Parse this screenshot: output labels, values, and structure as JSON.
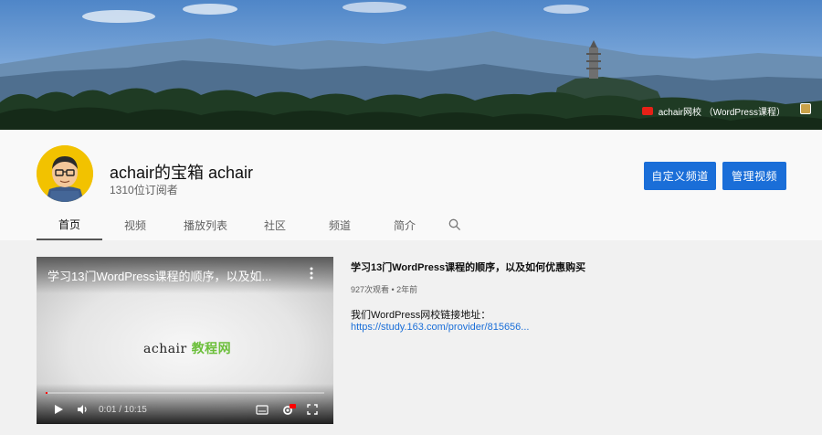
{
  "banner": {
    "link_text": "achair网校 （WordPress课程）",
    "icon": "youtube-play-icon"
  },
  "channel": {
    "name": "achair的宝箱 achair",
    "subscribers": "1310位订阅者",
    "avatar_icon": "cartoon-avatar"
  },
  "buttons": {
    "customize": "自定义频道",
    "manage": "管理视频",
    "color": "#1a6ed8"
  },
  "tabs": [
    {
      "label": "首页",
      "active": true
    },
    {
      "label": "视频",
      "active": false
    },
    {
      "label": "播放列表",
      "active": false
    },
    {
      "label": "社区",
      "active": false
    },
    {
      "label": "频道",
      "active": false
    },
    {
      "label": "简介",
      "active": false
    }
  ],
  "search_icon": "search-icon",
  "featured_video": {
    "player_title": "学习13门WordPress课程的顺序，以及如...",
    "logo_text": "achair",
    "logo_cn": "教程网",
    "time": "0:01 / 10:15",
    "progress": 0.0016,
    "title": "学习13门WordPress课程的顺序，以及如何优惠购买",
    "meta": "927次观看 • 2年前",
    "description": "我们WordPress网校链接地址：",
    "link": "https://study.163.com/provider/815656..."
  },
  "colors": {
    "accent": "#1a6ed8",
    "progress": "#ff0000",
    "logo_green": "#6cbf3b"
  }
}
